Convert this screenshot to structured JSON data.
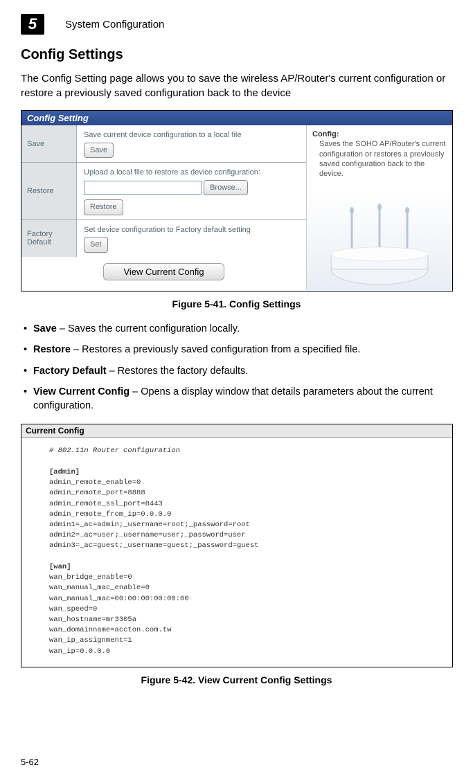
{
  "chapter": {
    "number": "5",
    "title": "System Configuration"
  },
  "section_title": "Config Settings",
  "intro": "The Config Setting page allows you to save the wireless AP/Router's current configuration or restore a previously saved configuration back to the device",
  "fig1": {
    "panel_title": "Config Setting",
    "rows": {
      "save": {
        "label": "Save",
        "desc": "Save current device configuration to a local file",
        "btn": "Save"
      },
      "restore": {
        "label": "Restore",
        "desc": "Upload a local file to restore as device configuration:",
        "browse": "Browse...",
        "btn": "Restore"
      },
      "factory": {
        "label": "Factory Default",
        "desc": "Set device configuration to Factory default setting",
        "btn": "Set"
      }
    },
    "view_btn": "View Current Config",
    "right": {
      "title": "Config:",
      "text": "Saves the SOHO AP/Router's current configuration or restores a previously saved configuration back to the device."
    },
    "caption": "Figure 5-41.   Config Settings"
  },
  "bullets": [
    {
      "term": "Save",
      "text": "  – Saves the current configuration locally."
    },
    {
      "term": "Restore",
      "text": "  – Restores a previously saved configuration from a specified file."
    },
    {
      "term": "Factory Default",
      "text": "  – Restores the factory defaults."
    },
    {
      "term": "View Current Config",
      "text": "  – Opens a display window that details parameters about the current configuration."
    }
  ],
  "fig2": {
    "title": "Current Config",
    "comment": "# 802.11n Router configuration",
    "admin_header": "[admin]",
    "admin_lines": "admin_remote_enable=0\nadmin_remote_port=8888\nadmin_remote_ssl_port=8443\nadmin_remote_from_ip=0.0.0.0\nadmin1=_ac=admin;_username=root;_password=root\nadmin2=_ac=user;_username=user;_password=user\nadmin3=_ac=guest;_username=guest;_password=guest",
    "wan_header": "[wan]",
    "wan_lines": "wan_bridge_enable=0\nwan_manual_mac_enable=0\nwan_manual_mac=00:00:00:00:00:00\nwan_speed=0\nwan_hostname=mr3305a\nwan_domainname=accton.com.tw\nwan_ip_assignment=1\nwan_ip=0.0.0.0",
    "caption": "Figure 5-42.   View Current Config Settings"
  },
  "page_number": "5-62"
}
